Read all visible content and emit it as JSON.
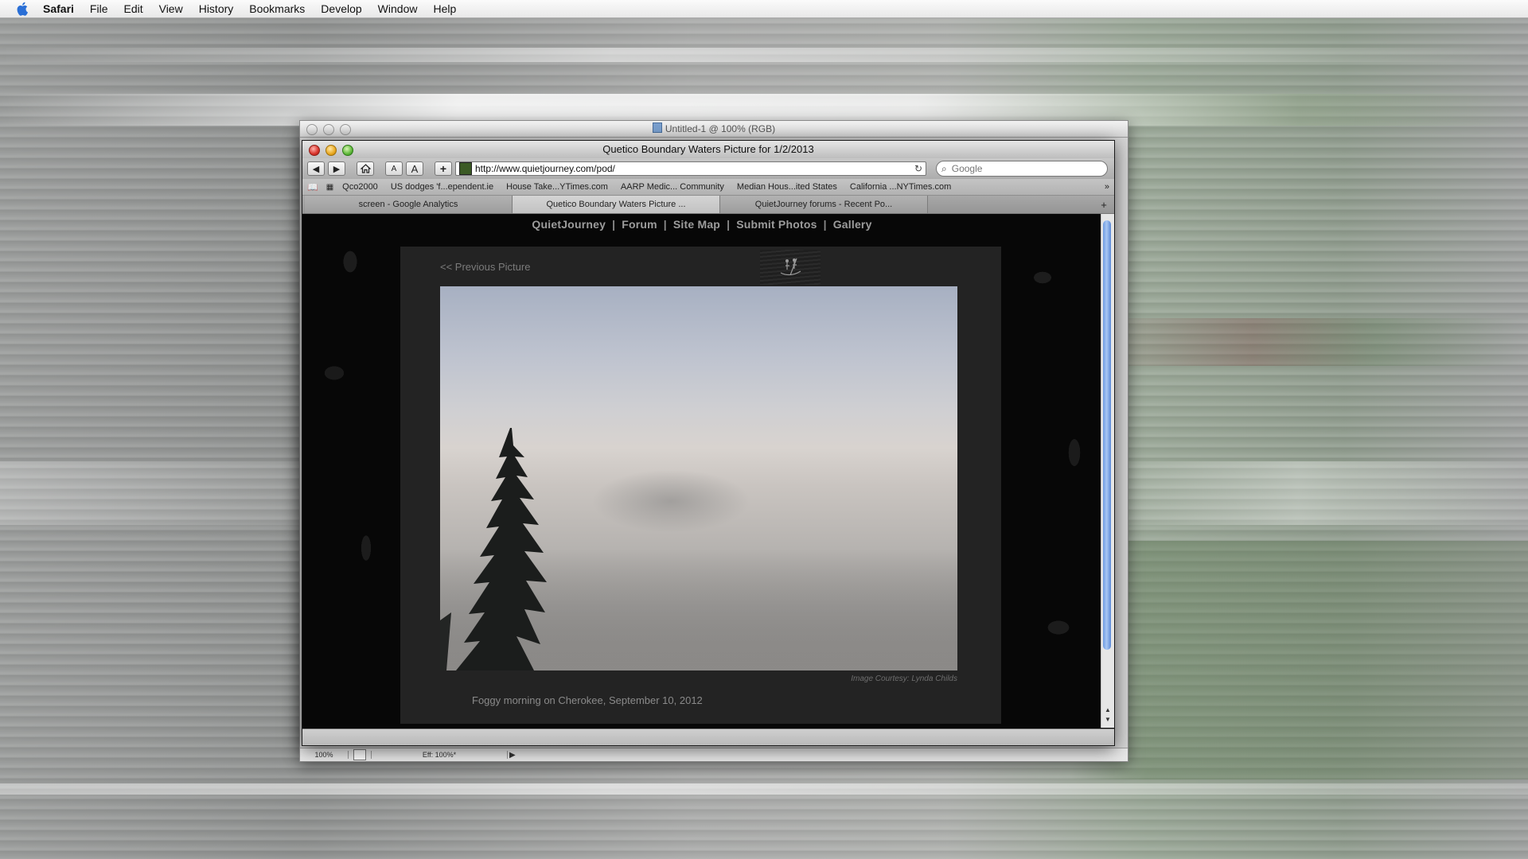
{
  "menubar": {
    "app": "Safari",
    "items": [
      "File",
      "Edit",
      "View",
      "History",
      "Bookmarks",
      "Develop",
      "Window",
      "Help"
    ]
  },
  "photoshop": {
    "title": "Untitled-1 @ 100% (RGB)",
    "zoom": "100%",
    "efficiency": "Eff: 100%*"
  },
  "safari": {
    "title": "Quetico Boundary Waters Picture for 1/2/2013",
    "url": "http://www.quietjourney.com/pod/",
    "search_placeholder": "Google",
    "bookmarks": [
      "Qco2000",
      "US dodges 'f...ependent.ie",
      "House Take...YTimes.com",
      "AARP Medic... Community",
      "Median Hous...ited States",
      "California ...NYTimes.com"
    ],
    "tabs": [
      "screen - Google Analytics",
      "Quetico Boundary Waters Picture ...",
      "QuietJourney forums - Recent Po..."
    ],
    "active_tab_index": 1
  },
  "page": {
    "nav": [
      "QuietJourney",
      "Forum",
      "Site Map",
      "Submit Photos",
      "Gallery"
    ],
    "nav_separator": "|",
    "prev_link": "<< Previous Picture",
    "credit": "Image Courtesy: Lynda Childs",
    "caption": "Foggy morning on Cherokee, September 10, 2012"
  }
}
